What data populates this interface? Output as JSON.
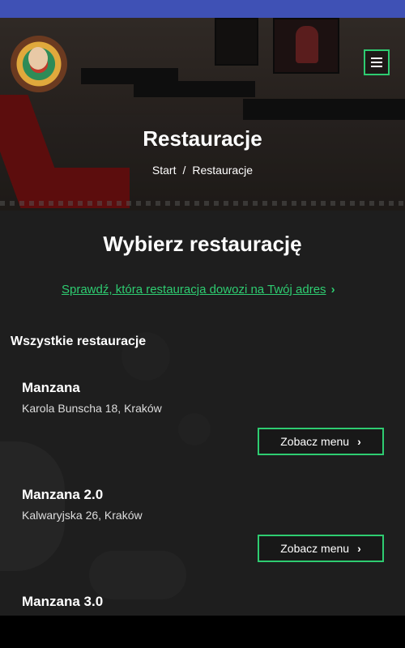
{
  "header": {
    "title": "Restauracje",
    "breadcrumb": [
      "Start",
      "/",
      "Restauracje"
    ]
  },
  "icons": {
    "logo": "restaurant-logo",
    "menu": "hamburger-menu-icon",
    "chevron": "chevron-right-icon"
  },
  "main": {
    "title": "Wybierz restaurację",
    "delivery_link": "Sprawdź, która restauracja dowozi na Twój adres",
    "chevron": "›",
    "section_title": "Wszystkie restauracje",
    "restaurants": [
      {
        "name": "Manzana",
        "address": "Karola Bunscha 18, Kraków",
        "button": "Zobacz menu"
      },
      {
        "name": "Manzana 2.0",
        "address": "Kalwaryjska 26, Kraków",
        "button": "Zobacz menu"
      },
      {
        "name": "Manzana 3.0",
        "address": "",
        "button": ""
      }
    ]
  },
  "colors": {
    "accent": "#2ecc71",
    "status_bar": "#3f51b5",
    "background": "#1e1e1e"
  }
}
